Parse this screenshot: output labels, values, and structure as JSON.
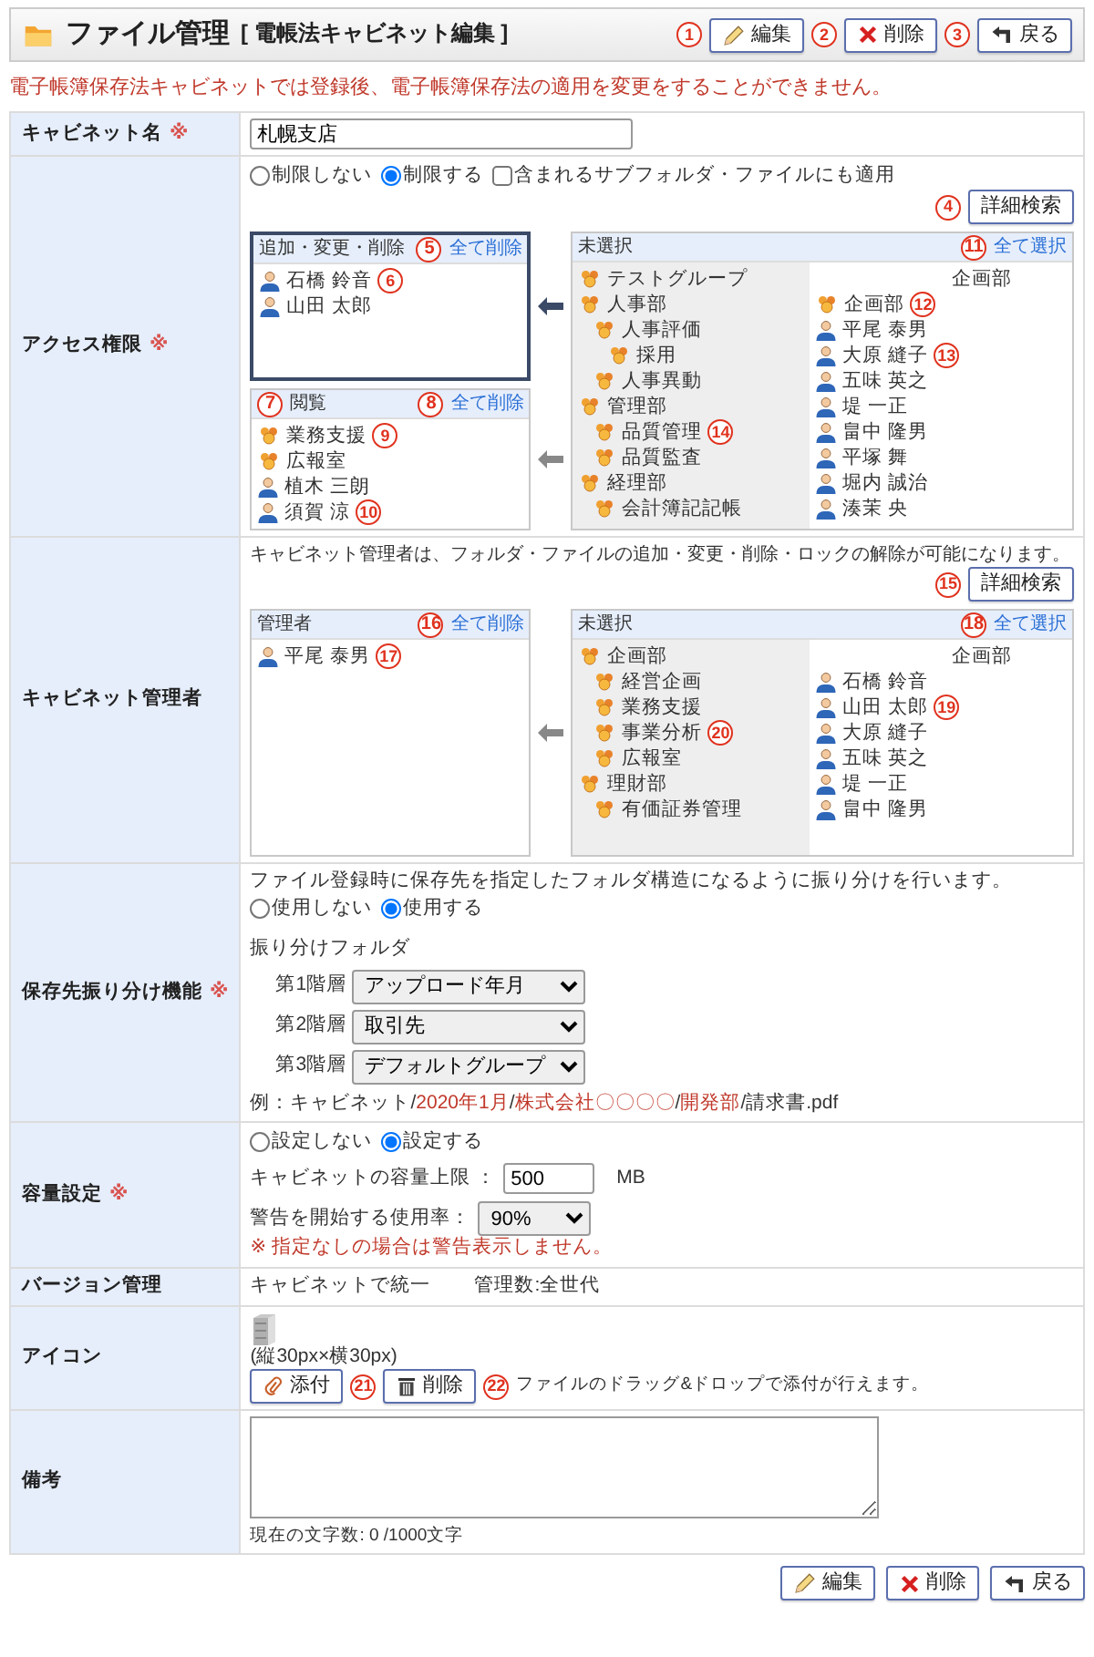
{
  "header": {
    "title": "ファイル管理",
    "subtitle": "[ 電帳法キャビネット編集 ]",
    "buttons": [
      {
        "kind": "edit",
        "label": "編集",
        "callout": "1"
      },
      {
        "kind": "delete",
        "label": "削除",
        "callout": "2"
      },
      {
        "kind": "back",
        "label": "戻る",
        "callout": "3"
      }
    ]
  },
  "notice": "電子帳簿保存法キャビネットでは登録後、電子帳簿保存法の適用を変更をすることができません。",
  "rows": [
    {
      "kind": "text_input",
      "label": "キャビネット名",
      "required_mark": "※",
      "value": "札幌支店"
    },
    {
      "kind": "dual_select",
      "label": "アクセス権限",
      "required_mark": "※",
      "options": [
        {
          "label": "制限しない",
          "selected": false
        },
        {
          "label": "制限する",
          "selected": true
        }
      ],
      "apply_sub": {
        "label": "含まれるサブフォルダ・ファイルにも適用",
        "checked": false
      },
      "search_button": {
        "label": "詳細検索",
        "callout": "4"
      },
      "selected_lists": [
        {
          "title": "追加・変更・削除",
          "action": {
            "label": "全て削除",
            "callout": "5"
          },
          "focused": true,
          "items": [
            {
              "kind": "user",
              "name": "石橋 鈴音",
              "callout": "6"
            },
            {
              "kind": "user",
              "name": "山田 太郎"
            }
          ]
        },
        {
          "title": "閲覧",
          "title_callout": "7",
          "action": {
            "label": "全て削除",
            "callout": "8"
          },
          "focused": false,
          "items": [
            {
              "kind": "group",
              "name": "業務支援",
              "callout": "9"
            },
            {
              "kind": "group",
              "name": "広報室"
            },
            {
              "kind": "user",
              "name": "植木 三朗"
            },
            {
              "kind": "user",
              "name": "須賀 涼",
              "callout": "10"
            }
          ]
        }
      ],
      "unselected": {
        "title": "未選択",
        "action": {
          "label": "全て選択",
          "callout": "11"
        },
        "tree": [
          {
            "name": "テストグループ"
          },
          {
            "name": "人事部",
            "children": [
              {
                "name": "人事評価",
                "children": [
                  {
                    "name": "採用"
                  }
                ]
              },
              {
                "name": "人事異動"
              }
            ]
          },
          {
            "name": "管理部",
            "children": [
              {
                "name": "品質管理",
                "callout": "14"
              },
              {
                "name": "品質監査"
              }
            ]
          },
          {
            "name": "経理部",
            "children": [
              {
                "name": "会計簿記記帳"
              }
            ]
          }
        ],
        "members_heading": "企画部",
        "members": [
          {
            "kind": "group",
            "name": "企画部",
            "callout": "12"
          },
          {
            "kind": "user",
            "name": "平尾 泰男"
          },
          {
            "kind": "user",
            "name": "大原 縫子",
            "callout": "13"
          },
          {
            "kind": "user",
            "name": "五味 英之"
          },
          {
            "kind": "user",
            "name": "堤 一正"
          },
          {
            "kind": "user",
            "name": "畠中 隆男"
          },
          {
            "kind": "user",
            "name": "平塚 舞"
          },
          {
            "kind": "user",
            "name": "堀内 誠治"
          },
          {
            "kind": "user",
            "name": "湊茉 央"
          }
        ]
      }
    },
    {
      "kind": "dual_select",
      "label": "キャビネット管理者",
      "description": "キャビネット管理者は、フォルダ・ファイルの追加・変更・削除・ロックの解除が可能になります。",
      "search_button": {
        "label": "詳細検索",
        "callout": "15"
      },
      "selected_lists": [
        {
          "title": "管理者",
          "action": {
            "label": "全て削除",
            "callout": "16"
          },
          "focused": false,
          "items": [
            {
              "kind": "user",
              "name": "平尾 泰男",
              "callout": "17"
            }
          ]
        }
      ],
      "unselected": {
        "title": "未選択",
        "action": {
          "label": "全て選択",
          "callout": "18"
        },
        "tree": [
          {
            "name": "企画部",
            "children": [
              {
                "name": "経営企画"
              },
              {
                "name": "業務支援"
              },
              {
                "name": "事業分析",
                "callout": "20"
              },
              {
                "name": "広報室"
              }
            ]
          },
          {
            "name": "理財部",
            "children": [
              {
                "name": "有価証券管理"
              }
            ]
          }
        ],
        "members_heading": "企画部",
        "members": [
          {
            "kind": "user",
            "name": "石橋 鈴音"
          },
          {
            "kind": "user",
            "name": "山田 太郎",
            "callout": "19"
          },
          {
            "kind": "user",
            "name": "大原 縫子"
          },
          {
            "kind": "user",
            "name": "五味 英之"
          },
          {
            "kind": "user",
            "name": "堤 一正"
          },
          {
            "kind": "user",
            "name": "畠中 隆男"
          }
        ]
      }
    },
    {
      "kind": "sorting",
      "label": "保存先振り分け機能",
      "required_mark": "※",
      "description": "ファイル登録時に保存先を指定したフォルダ構造になるように振り分けを行います。",
      "options": [
        {
          "label": "使用しない",
          "selected": false
        },
        {
          "label": "使用する",
          "selected": true
        }
      ],
      "folder_label": "振り分けフォルダ",
      "levels": [
        {
          "label": "第1階層",
          "value": "アップロード年月"
        },
        {
          "label": "第2階層",
          "value": "取引先"
        },
        {
          "label": "第3階層",
          "value": "デフォルトグループ"
        }
      ],
      "example": [
        {
          "text": "例：キャビネット/",
          "highlight": false
        },
        {
          "text": "2020年1月",
          "highlight": true
        },
        {
          "text": "/",
          "highlight": false
        },
        {
          "text": "株式会社〇〇〇〇",
          "highlight": true
        },
        {
          "text": "/",
          "highlight": false
        },
        {
          "text": "開発部",
          "highlight": true
        },
        {
          "text": "/請求書.pdf",
          "highlight": false
        }
      ]
    },
    {
      "kind": "capacity",
      "label": "容量設定",
      "required_mark": "※",
      "options": [
        {
          "label": "設定しない",
          "selected": false
        },
        {
          "label": "設定する",
          "selected": true
        }
      ],
      "limit_label": "キャビネットの容量上限 ：",
      "limit_value": "500",
      "limit_unit": "MB",
      "warning_label": "警告を開始する使用率：",
      "warning_value": "90%",
      "note": "※ 指定なしの場合は警告表示しません。"
    },
    {
      "kind": "version",
      "label": "バージョン管理",
      "values": [
        "キャビネットで統一",
        "管理数:全世代"
      ]
    },
    {
      "kind": "icon",
      "label": "アイコン",
      "size_note": "(縦30px×横30px)",
      "buttons": [
        {
          "kind": "attach",
          "label": "添付",
          "callout": "21"
        },
        {
          "kind": "delete_icon",
          "label": "削除",
          "callout": "22"
        }
      ],
      "hint": "ファイルのドラッグ&ドロップで添付が行えます。"
    },
    {
      "kind": "notes",
      "label": "備考",
      "counter": "現在の文字数: 0 /1000文字"
    }
  ],
  "footer_buttons": [
    {
      "kind": "edit",
      "label": "編集"
    },
    {
      "kind": "delete",
      "label": "削除"
    },
    {
      "kind": "back",
      "label": "戻る"
    }
  ]
}
